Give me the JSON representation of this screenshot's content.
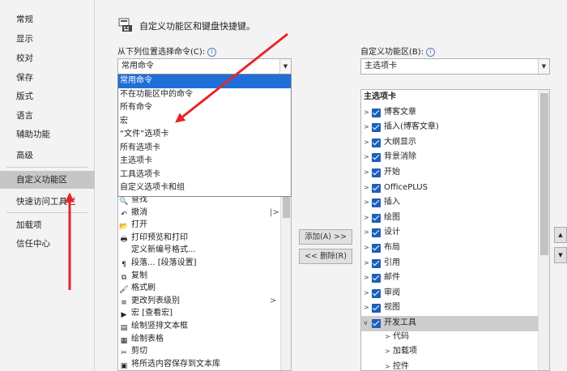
{
  "sidebar": {
    "items": [
      {
        "label": "常规"
      },
      {
        "label": "显示"
      },
      {
        "label": "校对"
      },
      {
        "label": "保存"
      },
      {
        "label": "版式"
      },
      {
        "label": "语言"
      },
      {
        "label": "辅助功能"
      },
      {
        "label": "高级"
      },
      {
        "label": "自定义功能区"
      },
      {
        "label": "快速访问工具栏"
      },
      {
        "label": "加载项"
      },
      {
        "label": "信任中心"
      }
    ]
  },
  "header": {
    "title": "自定义功能区和键盘快捷键。"
  },
  "left": {
    "label": "从下列位置选择命令(C):",
    "selected": "常用命令",
    "options": [
      "常用命令",
      "不在功能区中的命令",
      "所有命令",
      "宏",
      "“文件”选项卡",
      "所有选项卡",
      "主选项卡",
      "工具选项卡",
      "自定义选项卡和组"
    ],
    "commands": [
      {
        "icon": "search-icon",
        "glyph": "🔍",
        "label": "查找",
        "sub": ""
      },
      {
        "icon": "undo-icon",
        "glyph": "↶",
        "label": "撤消",
        "sub": "|>"
      },
      {
        "icon": "folder-icon",
        "glyph": "📂",
        "label": "打开",
        "sub": ""
      },
      {
        "icon": "print-preview-icon",
        "glyph": "🖶",
        "label": "打印预览和打印",
        "sub": ""
      },
      {
        "icon": "blank-icon",
        "glyph": "",
        "label": "定义新编号格式...",
        "sub": ""
      },
      {
        "icon": "paragraph-icon",
        "glyph": "¶",
        "label": "段落... [段落设置]",
        "sub": ""
      },
      {
        "icon": "copy-icon",
        "glyph": "⧉",
        "label": "复制",
        "sub": ""
      },
      {
        "icon": "format-painter-icon",
        "glyph": "🖌",
        "label": "格式刷",
        "sub": ""
      },
      {
        "icon": "list-level-icon",
        "glyph": "≡",
        "label": "更改列表级别",
        "sub": ">"
      },
      {
        "icon": "macro-icon",
        "glyph": "▶",
        "label": "宏 [查看宏]",
        "sub": ""
      },
      {
        "icon": "vertical-textbox-icon",
        "glyph": "▤",
        "label": "绘制竖排文本框",
        "sub": ""
      },
      {
        "icon": "table-icon",
        "glyph": "▦",
        "label": "绘制表格",
        "sub": ""
      },
      {
        "icon": "cut-icon",
        "glyph": "✂",
        "label": "剪切",
        "sub": ""
      },
      {
        "icon": "save-selection-icon",
        "glyph": "▣",
        "label": "将所选内容保存到文本库",
        "sub": ""
      }
    ]
  },
  "buttons": {
    "add": "添加(A) >>",
    "remove": "<< 删除(R)"
  },
  "right": {
    "label": "自定义功能区(B):",
    "selected": "主选项卡",
    "tree_header": "主选项卡",
    "tabs": [
      {
        "label": "博客文章",
        "expand": ">"
      },
      {
        "label": "插入(博客文章)",
        "expand": ">"
      },
      {
        "label": "大纲显示",
        "expand": ">"
      },
      {
        "label": "背景消除",
        "expand": ">"
      },
      {
        "label": "开始",
        "expand": ">"
      },
      {
        "label": "OfficePLUS",
        "expand": ">"
      },
      {
        "label": "插入",
        "expand": ">"
      },
      {
        "label": "绘图",
        "expand": ">"
      },
      {
        "label": "设计",
        "expand": ">"
      },
      {
        "label": "布局",
        "expand": ">"
      },
      {
        "label": "引用",
        "expand": ">"
      },
      {
        "label": "邮件",
        "expand": ">"
      },
      {
        "label": "审阅",
        "expand": ">"
      },
      {
        "label": "视图",
        "expand": ">"
      },
      {
        "label": "开发工具",
        "expand": "v"
      }
    ],
    "children": [
      "代码",
      "加载项",
      "控件"
    ]
  },
  "colors": {
    "accent": "#1e6fd9",
    "arrow": "#e8252a",
    "checkbox": "#1d5fb8"
  }
}
